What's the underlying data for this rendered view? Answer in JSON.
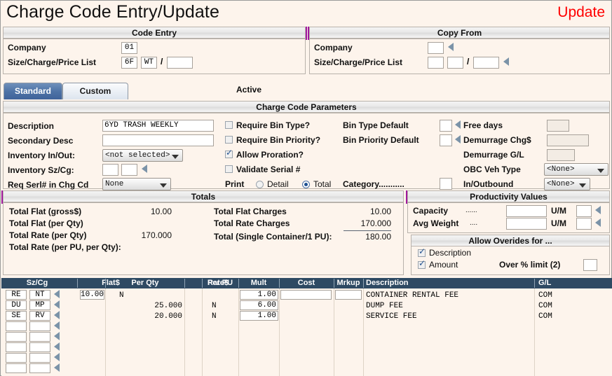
{
  "window": {
    "title": "Charge Code Entry/Update",
    "mode_label": "Update",
    "mode_color": "#ff0000"
  },
  "code_entry": {
    "header": "Code Entry",
    "company_label": "Company",
    "company_value": "01",
    "sizelist_label": "Size/Charge/Price List",
    "size_value": "6F",
    "charge_value": "WT",
    "slash": "/",
    "price_list_value": ""
  },
  "copy_from": {
    "header": "Copy From",
    "company_label": "Company",
    "company_value": "",
    "sizelist_label": "Size/Charge/Price List",
    "size_value": "",
    "charge_value": "",
    "slash": "/",
    "price_list_value": ""
  },
  "tabs": {
    "standard": "Standard",
    "custom": "Custom",
    "active_label": "Active"
  },
  "params": {
    "header": "Charge Code Parameters",
    "description_label": "Description",
    "description_value": "6YD TRASH WEEKLY",
    "secondary_label": "Secondary Desc",
    "secondary_value": "",
    "inventory_inout_label": "Inventory In/Out:",
    "inventory_inout_value": "<not selected>",
    "inventory_szcg_label": "Inventory Sz/Cg:",
    "inventory_sz_value": "",
    "inventory_cg_value": "",
    "req_serl_label": "Req Serl# in Chg Cd",
    "req_serl_value": "None",
    "require_bin_type_label": "Require Bin Type?",
    "require_bin_type_checked": false,
    "require_bin_priority_label": "Require Bin Priority?",
    "require_bin_priority_checked": false,
    "allow_proration_label": "Allow Proration?",
    "allow_proration_checked": true,
    "validate_serial_label": "Validate Serial #",
    "validate_serial_checked": false,
    "print_label": "Print",
    "print_detail_label": "Detail",
    "print_total_label": "Total",
    "print_selected": "Total",
    "bin_type_default_label": "Bin Type Default",
    "bin_type_default_value": "",
    "bin_priority_default_label": "Bin Priority Default",
    "bin_priority_default_value": "",
    "category_label": "Category...........",
    "category_value": "",
    "free_days_label": "Free days",
    "free_days_value": "",
    "demurrage_chg_label": "Demurrage Chg$",
    "demurrage_chg_value": "",
    "demurrage_gl_label": "Demurrage G/L",
    "demurrage_gl_value": "",
    "obc_veh_type_label": "OBC Veh Type",
    "obc_veh_type_value": "<None>",
    "inoutbound_label": "In/Outbound",
    "inoutbound_value": "<None>"
  },
  "totals": {
    "header": "Totals",
    "rows_left": [
      {
        "label": "Total Flat (gross$)",
        "value": "10.00"
      },
      {
        "label": "Total Flat (per Qty)",
        "value": ""
      },
      {
        "label": "Total Rate (per Qty)",
        "value": "170.000"
      },
      {
        "label": "Total Rate (per PU, per Qty):",
        "value": ""
      }
    ],
    "rows_right": [
      {
        "label": "Total Flat Charges",
        "value": "10.00"
      },
      {
        "label": "Total Rate Charges",
        "value": "170.000"
      },
      {
        "label": "Total (Single Container/1 PU):",
        "value": "180.00"
      }
    ]
  },
  "productivity": {
    "header": "Productivity Values",
    "capacity_label": "Capacity",
    "capacity_dots": "......",
    "capacity_value": "",
    "capacity_um_label": "U/M",
    "capacity_um_value": "",
    "avg_weight_label": "Avg Weight",
    "avg_weight_dots": "....",
    "avg_weight_value": "",
    "avg_weight_um_label": "U/M",
    "avg_weight_um_value": ""
  },
  "overrides": {
    "header": "Allow Overides for ...",
    "description_label": "Description",
    "description_checked": true,
    "amount_label": "Amount",
    "amount_checked": true,
    "over_limit_label": "Over % limit (2)",
    "over_limit_value": ""
  },
  "grid": {
    "columns": [
      "Sz/Cg",
      "Flat$",
      "Per Qty",
      "Rate$",
      "Per PU",
      "Mult",
      "Cost",
      "Mrkup",
      "Description",
      "G/L"
    ],
    "rows": [
      {
        "sz": "RE",
        "cg": "NT",
        "flat": "10.00",
        "per_qty": "N",
        "rate": "",
        "per_pu": "",
        "mult": "1.00",
        "cost": "",
        "mrkup": "",
        "description": "CONTAINER RENTAL FEE",
        "gl": "COM"
      },
      {
        "sz": "DU",
        "cg": "MP",
        "flat": "",
        "per_qty": "",
        "rate": "25.000",
        "per_pu": "N",
        "mult": "6.00",
        "cost": "",
        "mrkup": "",
        "description": "DUMP FEE",
        "gl": "COM"
      },
      {
        "sz": "SE",
        "cg": "RV",
        "flat": "",
        "per_qty": "",
        "rate": "20.000",
        "per_pu": "N",
        "mult": "1.00",
        "cost": "",
        "mrkup": "",
        "description": "SERVICE FEE",
        "gl": "COM"
      },
      {
        "sz": "",
        "cg": "",
        "flat": "",
        "per_qty": "",
        "rate": "",
        "per_pu": "",
        "mult": "",
        "cost": "",
        "mrkup": "",
        "description": "",
        "gl": ""
      },
      {
        "sz": "",
        "cg": "",
        "flat": "",
        "per_qty": "",
        "rate": "",
        "per_pu": "",
        "mult": "",
        "cost": "",
        "mrkup": "",
        "description": "",
        "gl": ""
      },
      {
        "sz": "",
        "cg": "",
        "flat": "",
        "per_qty": "",
        "rate": "",
        "per_pu": "",
        "mult": "",
        "cost": "",
        "mrkup": "",
        "description": "",
        "gl": ""
      },
      {
        "sz": "",
        "cg": "",
        "flat": "",
        "per_qty": "",
        "rate": "",
        "per_pu": "",
        "mult": "",
        "cost": "",
        "mrkup": "",
        "description": "",
        "gl": ""
      },
      {
        "sz": "",
        "cg": "",
        "flat": "",
        "per_qty": "",
        "rate": "",
        "per_pu": "",
        "mult": "",
        "cost": "",
        "mrkup": "",
        "description": "",
        "gl": ""
      }
    ]
  }
}
